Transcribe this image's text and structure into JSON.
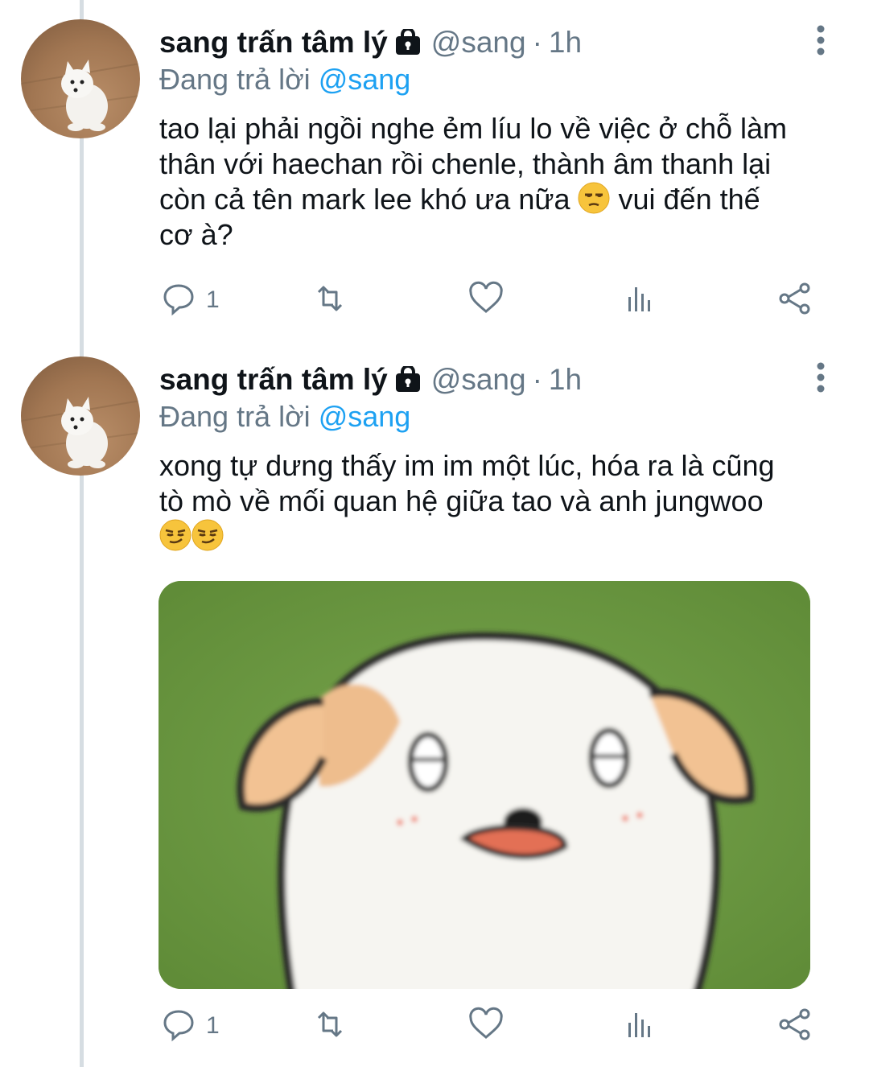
{
  "tweets": [
    {
      "author": {
        "name": "sang trấn tâm lý",
        "handle": "@sang",
        "time": "1h"
      },
      "reply": {
        "prefix": "Đang trả lời",
        "mention": "@sang"
      },
      "text_lines": [
        "tao lại phải ngồi nghe ẻm líu lo về việc ở chỗ làm",
        "thân với haechan rồi chenle, thành âm thanh lại",
        "còn cả tên mark lee khó ưa nữa",
        "vui đến thế",
        "cơ à?"
      ],
      "emoji": [
        "unamused-face"
      ],
      "counts": {
        "reply": "1"
      },
      "icons": [
        "lock-icon",
        "more-icon",
        "reply-icon",
        "retweet-icon",
        "like-icon",
        "analytics-icon",
        "share-icon"
      ]
    },
    {
      "author": {
        "name": "sang trấn tâm lý",
        "handle": "@sang",
        "time": "1h"
      },
      "reply": {
        "prefix": "Đang trả lời",
        "mention": "@sang"
      },
      "text_lines": [
        "xong tự dưng thấy im im một lúc, hóa ra là cũng",
        "tò mò về mối quan hệ giữa tao và anh jungwoo"
      ],
      "emoji": [
        "smirking-face",
        "smirking-face"
      ],
      "media": "cartoon puppy image",
      "counts": {
        "reply": "1"
      },
      "icons": [
        "lock-icon",
        "more-icon",
        "reply-icon",
        "retweet-icon",
        "like-icon",
        "analytics-icon",
        "share-icon"
      ]
    }
  ],
  "colors": {
    "text": "#0f1419",
    "secondary": "#657786",
    "mention": "#1da1f2",
    "thread": "#d6dde2"
  }
}
